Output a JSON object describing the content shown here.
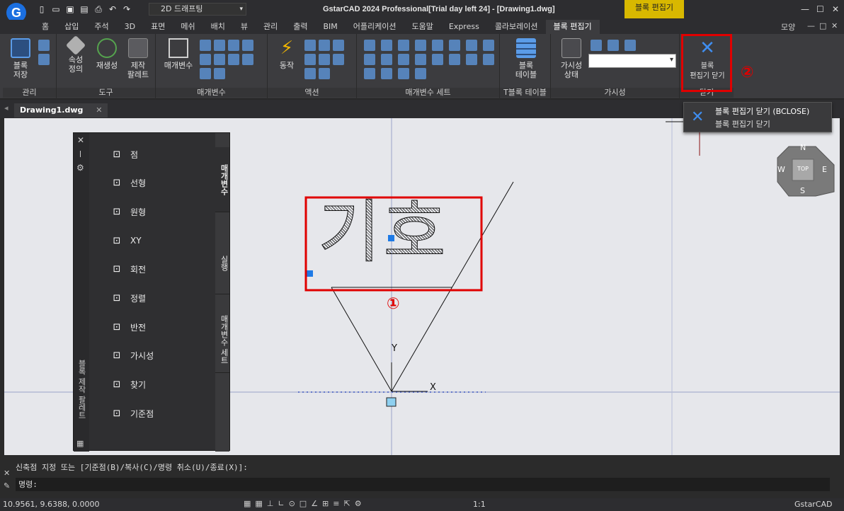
{
  "app": {
    "title": "GstarCAD 2024 Professional[Trial day left 24] - [Drawing1.dwg]",
    "context_tab": "블록 편집기",
    "workspace": "2D 드래프팅",
    "logo_letter": "G",
    "window_controls": [
      "—",
      "☐",
      "✕"
    ]
  },
  "ribbon_tabs": [
    "홈",
    "삽입",
    "주석",
    "3D",
    "표면",
    "메쉬",
    "배치",
    "뷰",
    "관리",
    "출력",
    "BIM",
    "어플리케이션",
    "도움말",
    "Express",
    "콜라보레이션",
    "블록 편집기"
  ],
  "ribbon_tabs_active": "블록 편집기",
  "ribbon_right": {
    "style_label": "모양",
    "controls": [
      "—",
      "□",
      "✕"
    ]
  },
  "panels": {
    "manage": {
      "title": "관리",
      "save_label": "블록\n저장"
    },
    "tools": {
      "title": "도구",
      "attr_label": "속성\n정의",
      "regen_label": "재생성",
      "palette_label": "제작\n팔레트"
    },
    "params": {
      "title": "매개변수",
      "param_label": "매개변수"
    },
    "actions": {
      "title": "액션",
      "action_label": "동작"
    },
    "paramsets": {
      "title": "매개변수 세트"
    },
    "table": {
      "title": "T블록 테이블",
      "table_label": "블록\n테이블"
    },
    "visibility": {
      "title": "가시성",
      "vis_label": "가시성\n상태"
    },
    "close": {
      "title": "닫기",
      "close_label": "블록\n편집기 닫기"
    }
  },
  "annotations": {
    "marker1": "①",
    "marker2": "②"
  },
  "doc_tab": {
    "name": "Drawing1.dwg",
    "close": "✕"
  },
  "tooltip": {
    "title": "블록 편집기 닫기 (BCLOSE)",
    "desc": "블록 편집기 닫기"
  },
  "drawing": {
    "block_text": "기호",
    "y_label": "Y",
    "x_label": "X"
  },
  "viewcube": {
    "top": "TOP",
    "n": "N",
    "s": "S",
    "e": "E",
    "w": "W"
  },
  "palette": {
    "title": "블록 제작 팔레트",
    "items": [
      {
        "label": "점",
        "icon": "point-param-icon"
      },
      {
        "label": "선형",
        "icon": "linear-param-icon"
      },
      {
        "label": "원형",
        "icon": "polar-param-icon"
      },
      {
        "label": "XY",
        "icon": "xy-param-icon"
      },
      {
        "label": "회전",
        "icon": "rotation-param-icon"
      },
      {
        "label": "정렬",
        "icon": "alignment-param-icon"
      },
      {
        "label": "반전",
        "icon": "flip-param-icon"
      },
      {
        "label": "가시성",
        "icon": "visibility-param-icon"
      },
      {
        "label": "찾기",
        "icon": "lookup-param-icon"
      },
      {
        "label": "기준점",
        "icon": "basepoint-param-icon"
      }
    ],
    "tabs": [
      "매개변수",
      "실행",
      "매개변수 세트"
    ]
  },
  "command": {
    "history": "신축점 지정 또는 [기준점(B)/복사(C)/명령 취소(U)/종료(X)]:",
    "prompt": "명령:"
  },
  "status": {
    "coords": "10.9561, 9.6388, 0.0000",
    "scale": "1:1",
    "brand": "GstarCAD"
  }
}
